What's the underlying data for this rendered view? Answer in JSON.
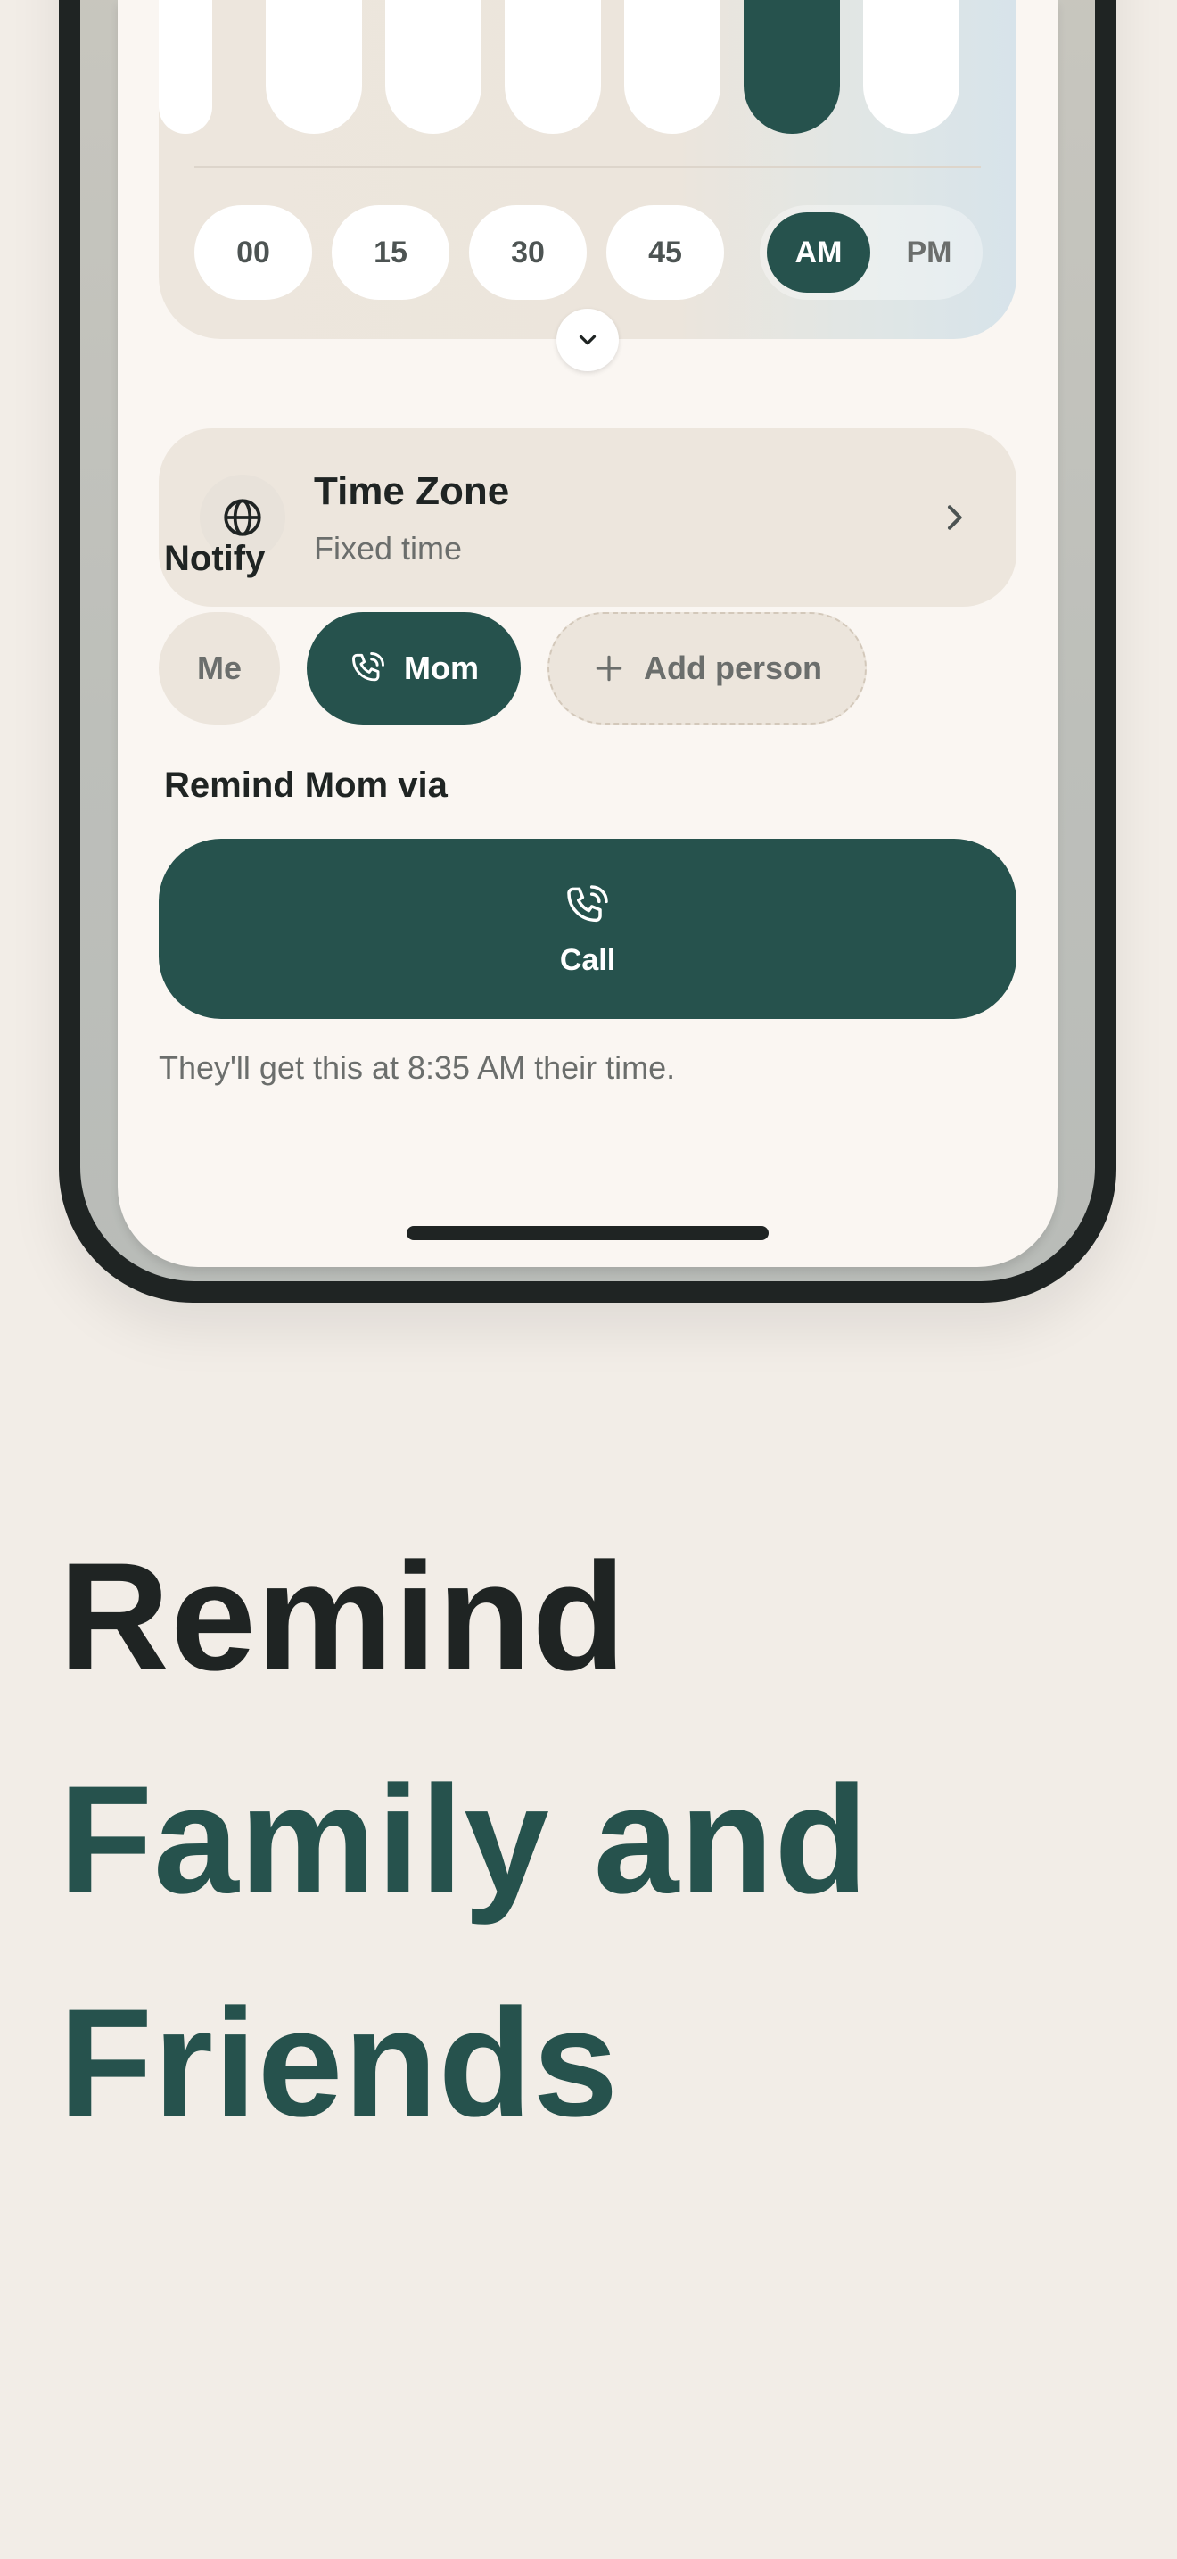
{
  "time_picker": {
    "minutes": [
      "00",
      "15",
      "30",
      "45"
    ],
    "am_label": "AM",
    "pm_label": "PM",
    "selected_meridiem": "AM"
  },
  "time_zone": {
    "title": "Time Zone",
    "subtitle": "Fixed time",
    "icon": "globe-icon"
  },
  "notify": {
    "label": "Notify",
    "chips": {
      "me": "Me",
      "mom": "Mom",
      "add_person": "Add person"
    }
  },
  "remind_via": {
    "label": "Remind Mom via",
    "call_label": "Call"
  },
  "helper_text": "They'll get this at 8:35 AM their time.",
  "headline": {
    "line1": "Remind",
    "line2": "Family and",
    "line3": "Friends"
  },
  "colors": {
    "accent": "#26524d",
    "background": "#f2ede7",
    "card": "#ede6dd",
    "text_dark": "#1f2423",
    "text_muted": "#6b6e6c"
  }
}
